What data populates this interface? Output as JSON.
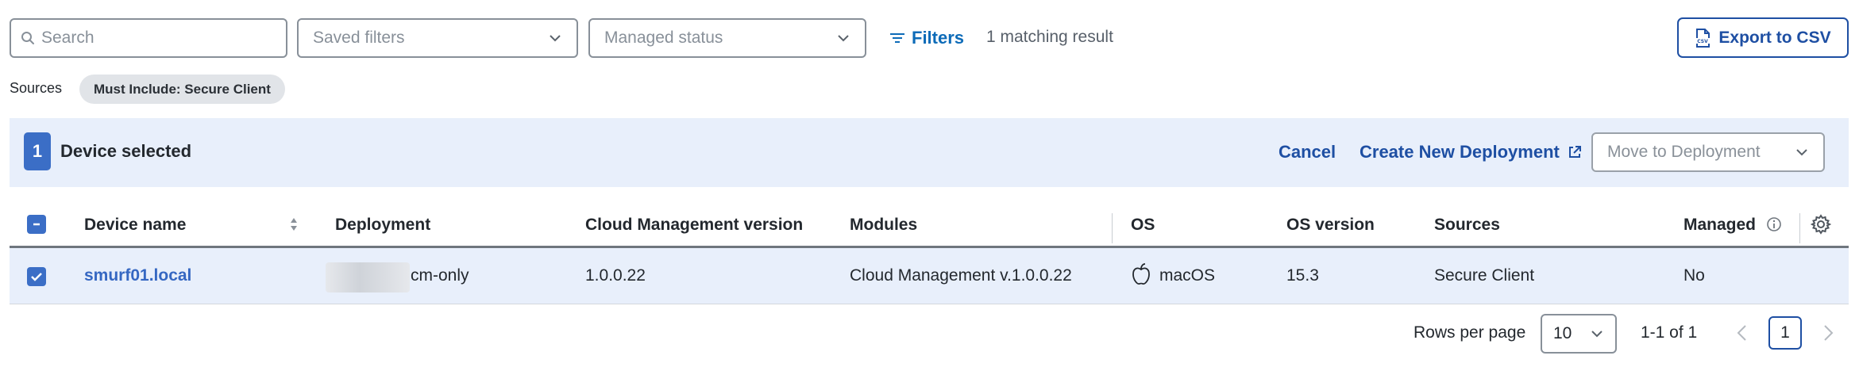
{
  "toolbar": {
    "search_placeholder": "Search",
    "saved_filters": "Saved filters",
    "managed_status": "Managed status",
    "filters_label": "Filters",
    "match_count": "1 matching result",
    "export_label": "Export to CSV"
  },
  "sources": {
    "label": "Sources",
    "chip": "Must Include: Secure Client"
  },
  "selection": {
    "count": "1",
    "text": "Device selected",
    "cancel": "Cancel",
    "create": "Create New Deployment",
    "move_placeholder": "Move to Deployment"
  },
  "table": {
    "headers": {
      "device": "Device name",
      "deployment": "Deployment",
      "cm_version": "Cloud Management version",
      "modules": "Modules",
      "os": "OS",
      "os_version": "OS version",
      "sources": "Sources",
      "managed": "Managed"
    },
    "rows": [
      {
        "device": "smurf01.local",
        "deployment": "cm-only",
        "cm_version": "1.0.0.22",
        "modules": "Cloud Management v.1.0.0.22",
        "os": "macOS",
        "os_version": "15.3",
        "sources": "Secure Client",
        "managed": "No"
      }
    ]
  },
  "pagination": {
    "rows_per_page_label": "Rows per page",
    "rows_per_page": "10",
    "range": "1-1 of 1",
    "current_page": "1"
  },
  "colors": {
    "accent": "#1e4fa3",
    "selection_bg": "#e8effb",
    "checkbox": "#3b6ec6"
  }
}
